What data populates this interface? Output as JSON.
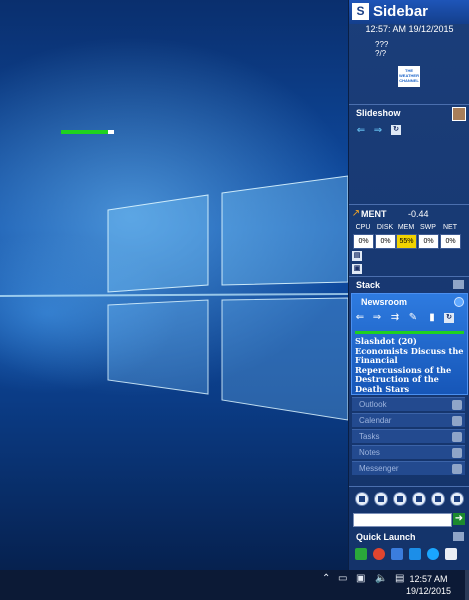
{
  "sidebar": {
    "brand": "Sidebar",
    "datetime": "12:57: AM 19/12/2015",
    "weather": {
      "line1": "???",
      "line2": "?/?",
      "channel_logo": "THE WEATHER CHANNEL"
    },
    "slideshow": {
      "title": "Slideshow"
    },
    "performance": {
      "ticker": "MENT",
      "change": "-0.44",
      "labels": [
        "CPU",
        "DISK",
        "MEM",
        "SWP",
        "NET"
      ],
      "values": [
        "0%",
        "0%",
        "55%",
        "0%",
        "0%"
      ]
    },
    "stack": {
      "title": "Stack",
      "newsroom": {
        "title": "Newsroom",
        "headline": "Slashdot (20) Economists Discuss the Financial Repercussions of the Destruction of the Death Stars"
      },
      "tabs": [
        "Outlook",
        "Calendar",
        "Tasks",
        "Notes",
        "Messenger"
      ]
    },
    "quick_launch": {
      "title": "Quick Launch"
    }
  },
  "taskbar": {
    "time": "12:57 AM",
    "date": "19/12/2015"
  },
  "colors": {
    "accent": "#1e55b8",
    "meter_hot": "#f2d300",
    "bar_green": "#1fd21f"
  }
}
